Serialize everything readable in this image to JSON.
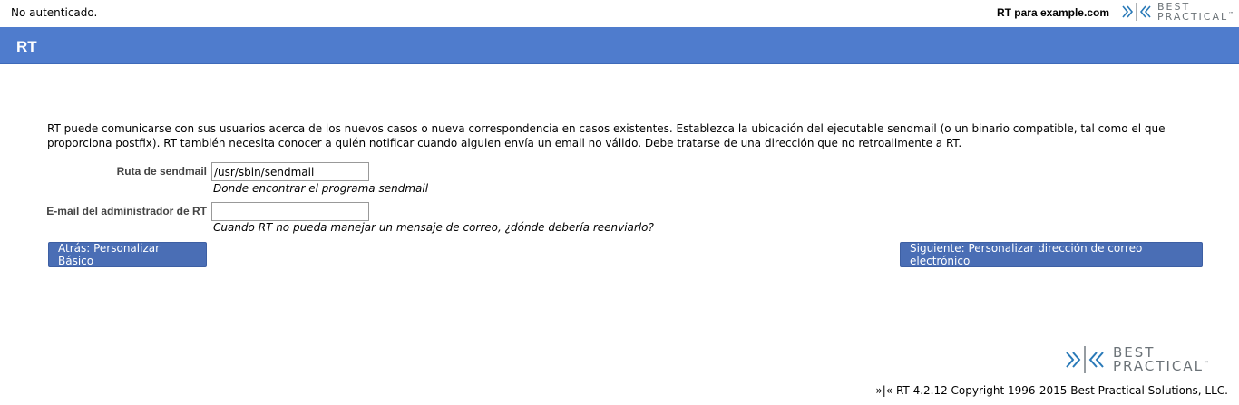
{
  "topbar": {
    "status": "No autenticado.",
    "site": "RT para example.com"
  },
  "brand": {
    "logo_line1": "BEST",
    "logo_line2": "PRACTICAL",
    "trademark": "™",
    "accent_color": "#2a7ab8",
    "text_color": "#6b7277"
  },
  "header": {
    "title": "RT",
    "background_color": "#4f7ccd"
  },
  "main": {
    "intro": "RT puede comunicarse con sus usuarios acerca de los nuevos casos o nueva correspondencia en casos existentes. Establezca la ubicación del ejecutable sendmail (o un binario compatible, tal como el que proporciona postfix). RT también necesita conocer a quién notificar cuando alguien envía un email no válido. Debe tratarse de una dirección que no retroalimente a RT.",
    "fields": {
      "sendmail_path": {
        "label": "Ruta de sendmail",
        "value": "/usr/sbin/sendmail",
        "hint": "Donde encontrar el programa sendmail"
      },
      "admin_email": {
        "label": "E-mail del administrador de RT",
        "value": "",
        "hint": "Cuando RT no pueda manejar un mensaje de correo, ¿dónde debería reenviarlo?"
      }
    },
    "buttons": {
      "back": "Atrás: Personalizar Básico",
      "next": "Siguiente: Personalizar dirección de correo electrónico"
    }
  },
  "footer": {
    "copyright": "»|« RT 4.2.12 Copyright 1996-2015 Best Practical Solutions, LLC."
  }
}
